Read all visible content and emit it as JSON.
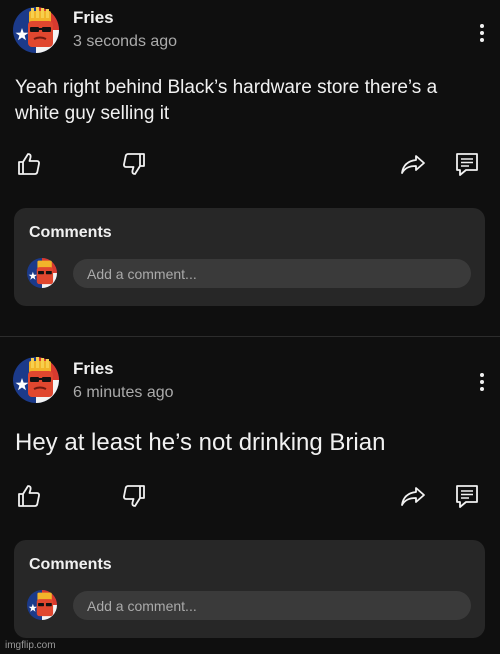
{
  "posts": [
    {
      "author": "Fries",
      "time": "3 seconds ago",
      "text": "Yeah right behind Black’s hardware store there’s a white guy selling it",
      "comments_title": "Comments",
      "comment_placeholder": "Add a comment..."
    },
    {
      "author": "Fries",
      "time": "6 minutes ago",
      "text": "Hey at least he’s not drinking Brian",
      "comments_title": "Comments",
      "comment_placeholder": "Add a comment..."
    }
  ],
  "watermark": "imgflip.com",
  "icons": {
    "like": "thumbs-up-icon",
    "dislike": "thumbs-down-icon",
    "share": "share-icon",
    "comment": "comment-icon",
    "more": "more-vertical-icon"
  },
  "colors": {
    "background": "#0f0f0f",
    "card": "#272727",
    "input": "#3a3a3a",
    "text": "#f1f1f1",
    "muted": "#aaaaaa"
  }
}
